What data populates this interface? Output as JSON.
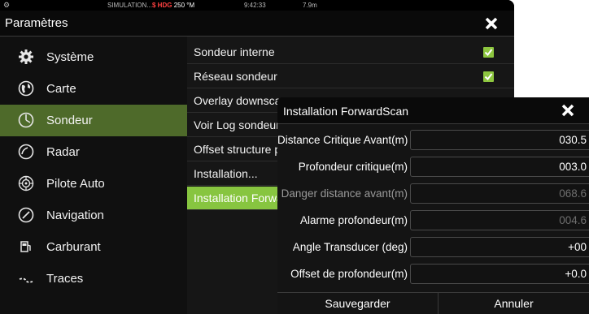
{
  "statusbar": {
    "simulation": "SIMULATION...",
    "heading_prefix": "$ HDG",
    "heading_value": "250",
    "heading_unit": "°M",
    "time": "9:42:33",
    "depth": "7.9m"
  },
  "window": {
    "title": "Paramètres"
  },
  "sidebar": {
    "items": [
      {
        "label": "Système",
        "icon": "gear-icon"
      },
      {
        "label": "Carte",
        "icon": "globe-icon"
      },
      {
        "label": "Sondeur",
        "icon": "sonar-icon",
        "active": true
      },
      {
        "label": "Radar",
        "icon": "radar-icon"
      },
      {
        "label": "Pilote Auto",
        "icon": "helm-icon"
      },
      {
        "label": "Navigation",
        "icon": "compass-icon"
      },
      {
        "label": "Carburant",
        "icon": "fuel-pump-icon"
      },
      {
        "label": "Traces",
        "icon": "trail-icon"
      }
    ]
  },
  "list": {
    "items": [
      {
        "label": "Sondeur interne",
        "checked": true
      },
      {
        "label": "Réseau sondeur",
        "checked": true
      },
      {
        "label": "Overlay downscan"
      },
      {
        "label": "Voir Log sondeur..."
      },
      {
        "label": "Offset structure pr"
      },
      {
        "label": "Installation..."
      },
      {
        "label": "Installation Forwa",
        "active": true
      }
    ]
  },
  "dialog": {
    "title": "Installation ForwardScan",
    "fields": [
      {
        "label": "Distance Critique Avant(m)",
        "value": "030.5"
      },
      {
        "label": "Profondeur critique(m)",
        "value": "003.0"
      },
      {
        "label": "Danger distance avant(m)",
        "value": "068.6",
        "disabled": true
      },
      {
        "label": "Alarme profondeur(m)",
        "value": "004.6",
        "disabled": true
      },
      {
        "label": "Angle Transducer (deg)",
        "value": "+00"
      },
      {
        "label": "Offset de profondeur(m)",
        "value": "+0.0"
      }
    ],
    "save_label": "Sauvegarder",
    "cancel_label": "Annuler"
  },
  "colors": {
    "accent_green": "#87c540",
    "active_sidebar": "#4e6a2a",
    "check_green": "#8dc63f"
  }
}
